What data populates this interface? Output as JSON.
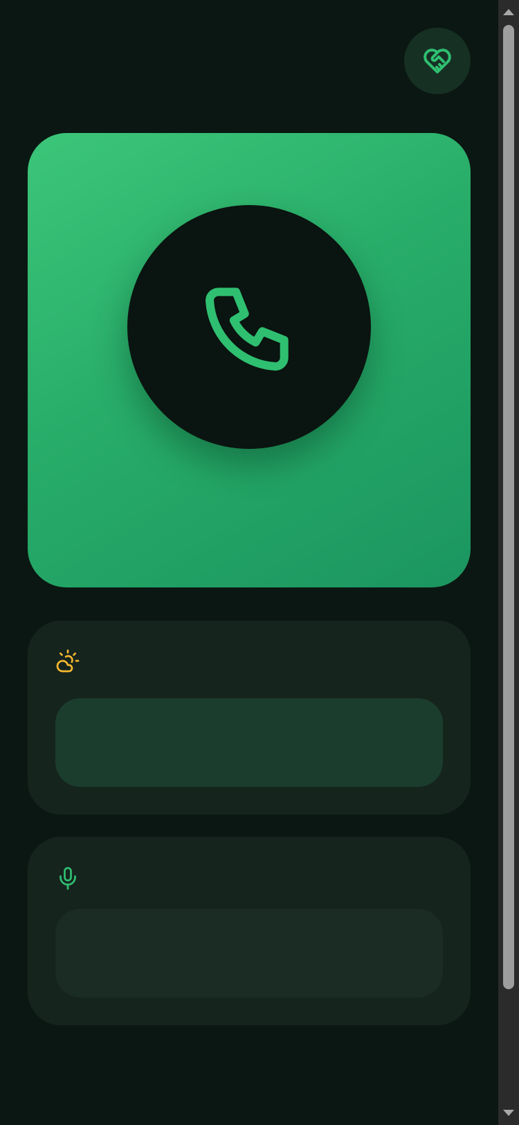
{
  "header": {
    "favorite_icon": "heart-handshake-icon"
  },
  "hero": {
    "call_icon": "phone-icon"
  },
  "weather_panel": {
    "icon": "sun-cloud-icon"
  },
  "voice_panel": {
    "icon": "microphone-icon"
  },
  "colors": {
    "background": "#0b1712",
    "accent_green": "#2fbf71",
    "hero_gradient_start": "#3cc67a",
    "hero_gradient_end": "#1b9560",
    "panel": "#16241e",
    "weather_icon": "#f5b82e",
    "voice_icon": "#2fbf71"
  }
}
